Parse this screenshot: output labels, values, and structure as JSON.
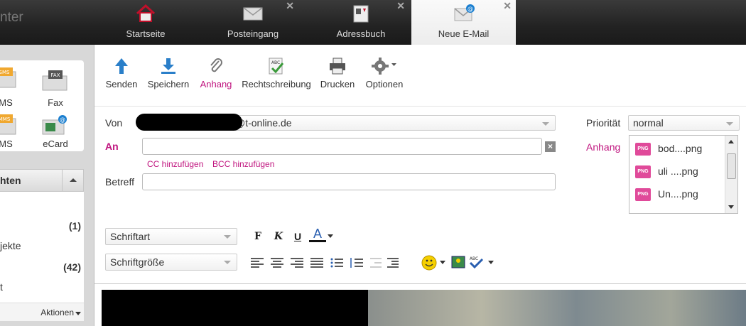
{
  "brand": "nter",
  "tabs": [
    {
      "label": "Startseite",
      "icon": "home-icon",
      "closable": false
    },
    {
      "label": "Posteingang",
      "icon": "envelope-icon",
      "closable": true
    },
    {
      "label": "Adressbuch",
      "icon": "address-book-icon",
      "closable": true
    },
    {
      "label": "Neue E-Mail",
      "icon": "new-mail-icon",
      "closable": true,
      "active": true
    }
  ],
  "sidebar": {
    "tiles": [
      {
        "label": "MS",
        "icon": "sms-icon"
      },
      {
        "label": "Fax",
        "icon": "fax-icon"
      },
      {
        "label": "MS",
        "icon": "mms-icon"
      },
      {
        "label": "eCard",
        "icon": "ecard-icon"
      }
    ],
    "section_title": "hten",
    "rows": [
      {
        "label": "",
        "count": "(1)"
      },
      {
        "label": "jekte",
        "count": ""
      },
      {
        "label": "",
        "count": "(42)"
      },
      {
        "label": "t",
        "count": ""
      }
    ],
    "actions_label": "Aktionen"
  },
  "toolbar": {
    "send": "Senden",
    "save": "Speichern",
    "attach": "Anhang",
    "spellcheck": "Rechtschreibung",
    "print": "Drucken",
    "options": "Optionen"
  },
  "form": {
    "from_label": "Von",
    "from_value": "@t-online.de",
    "to_label": "An",
    "to_value": "",
    "cc_link": "CC hinzufügen",
    "bcc_link": "BCC hinzufügen",
    "subject_label": "Betreff",
    "subject_value": "",
    "priority_label": "Priorität",
    "priority_value": "normal",
    "attachments_label": "Anhang",
    "attachments": [
      {
        "name": "bod....png",
        "type": "PNG"
      },
      {
        "name": "uli ....png",
        "type": "PNG"
      },
      {
        "name": "Un....png",
        "type": "PNG"
      }
    ],
    "close_x": "×"
  },
  "formatting": {
    "font_family": "Schriftart",
    "font_size": "Schriftgröße",
    "bold": "F",
    "italic": "K",
    "underline": "U",
    "color": "A"
  },
  "colors": {
    "accent": "#c0157f",
    "topbar": "#222222"
  }
}
